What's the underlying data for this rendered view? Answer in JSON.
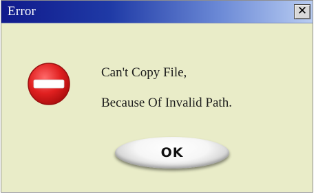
{
  "dialog": {
    "title": "Error",
    "close_glyph": "✕",
    "icon": "error-stop-icon",
    "message_lines": [
      "Can't Copy File,",
      "Because Of Invalid Path."
    ],
    "ok_label": "OK"
  },
  "colors": {
    "titlebar_start": "#101a8c",
    "titlebar_end": "#b9cdf2",
    "body_background": "#e9ecc8",
    "error_red": "#e02020"
  }
}
